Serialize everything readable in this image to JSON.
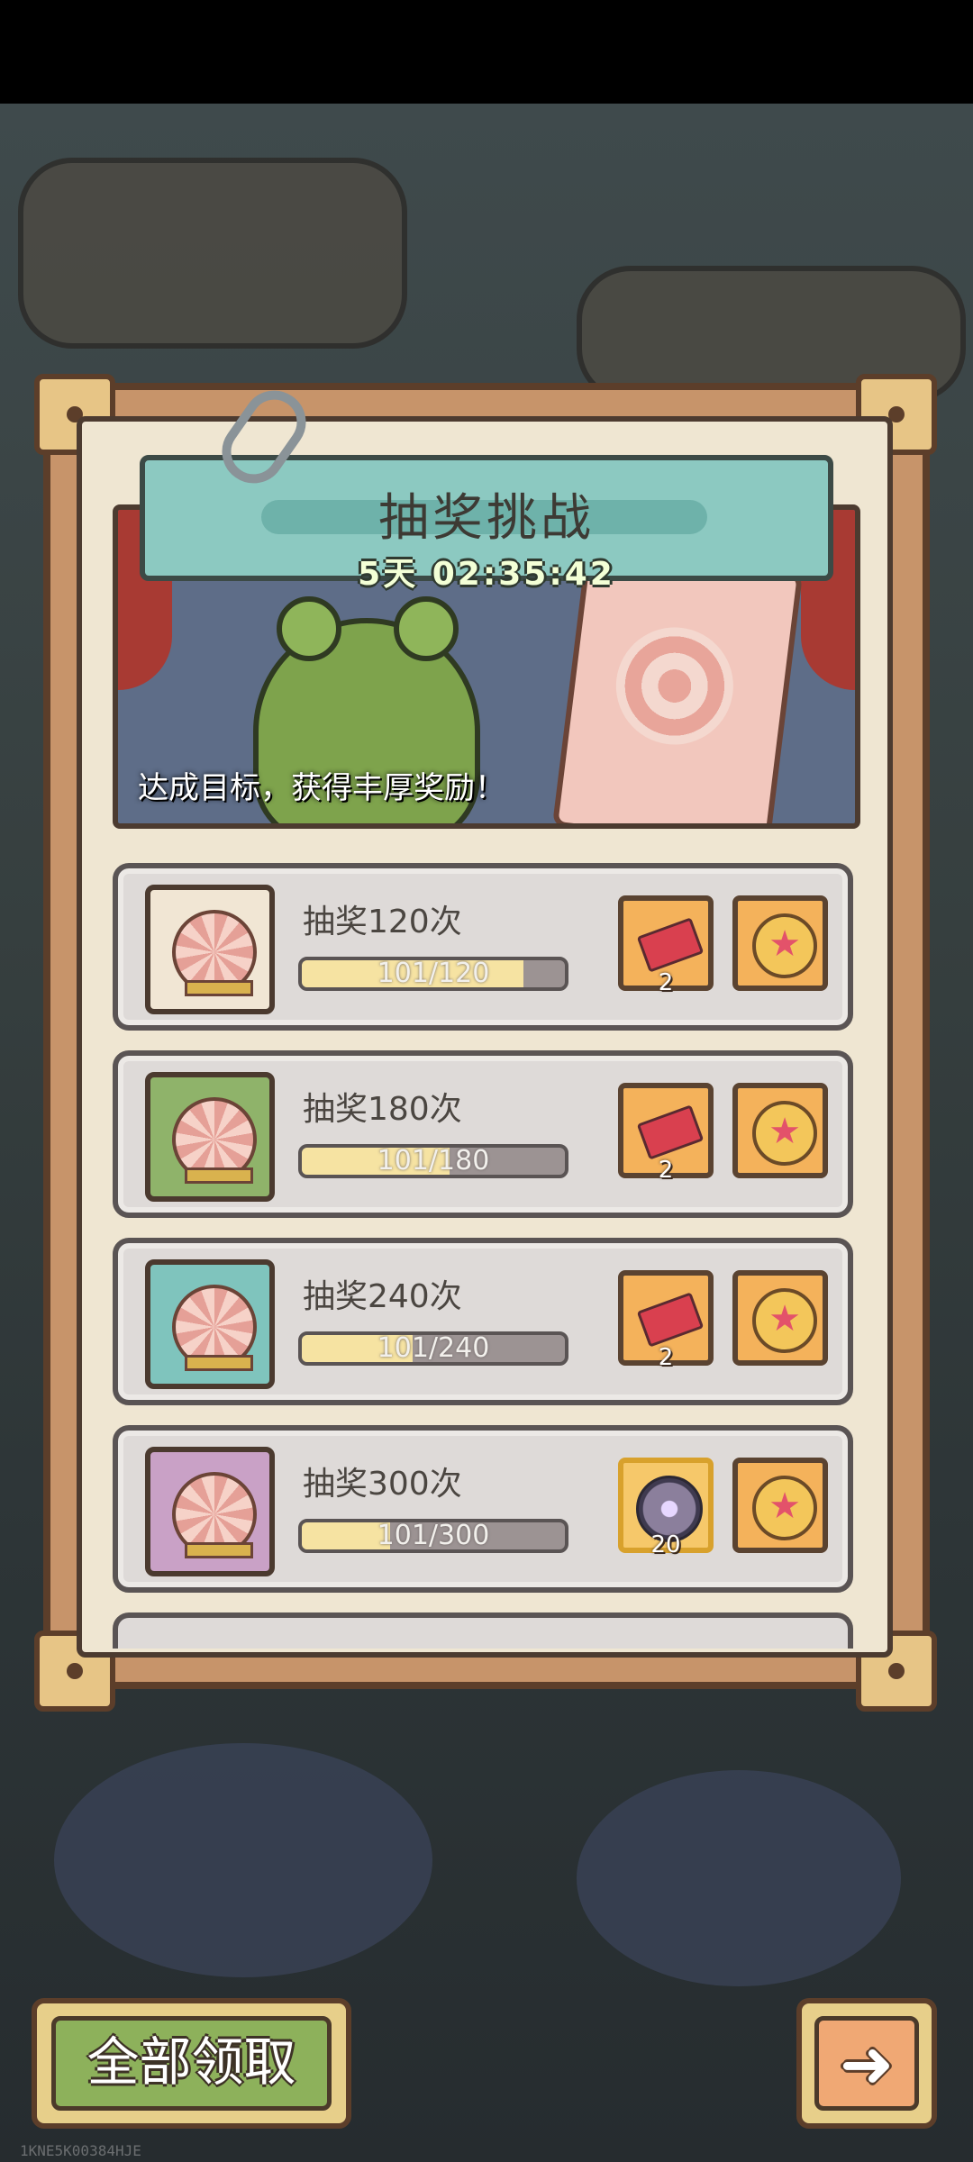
{
  "event": {
    "title": "抽奖挑战",
    "timer": "5天 02:35:42",
    "caption": "达成目标，获得丰厚奖励！"
  },
  "tasks": [
    {
      "title": "抽奖120次",
      "progress_text": "101/120",
      "progress": 0.842,
      "icon_bg": "#f1e6d4",
      "rewards": [
        {
          "icon": "ticket-icon",
          "count": "2"
        },
        {
          "icon": "star-medal-icon",
          "count": ""
        }
      ]
    },
    {
      "title": "抽奖180次",
      "progress_text": "101/180",
      "progress": 0.561,
      "icon_bg": "#8fb36a",
      "rewards": [
        {
          "icon": "ticket-icon",
          "count": "2"
        },
        {
          "icon": "star-medal-icon",
          "count": ""
        }
      ]
    },
    {
      "title": "抽奖240次",
      "progress_text": "101/240",
      "progress": 0.421,
      "icon_bg": "#7fc4bd",
      "rewards": [
        {
          "icon": "ticket-icon",
          "count": "2"
        },
        {
          "icon": "star-medal-icon",
          "count": ""
        }
      ]
    },
    {
      "title": "抽奖300次",
      "progress_text": "101/300",
      "progress": 0.337,
      "icon_bg": "#c9a1c6",
      "rewards": [
        {
          "icon": "orb-icon",
          "count": "20"
        },
        {
          "icon": "star-medal-icon",
          "count": ""
        }
      ]
    }
  ],
  "buttons": {
    "claim_all": "全部领取",
    "next_icon": "arrow-right-icon"
  },
  "watermark": "1KNE5K00384HJE"
}
